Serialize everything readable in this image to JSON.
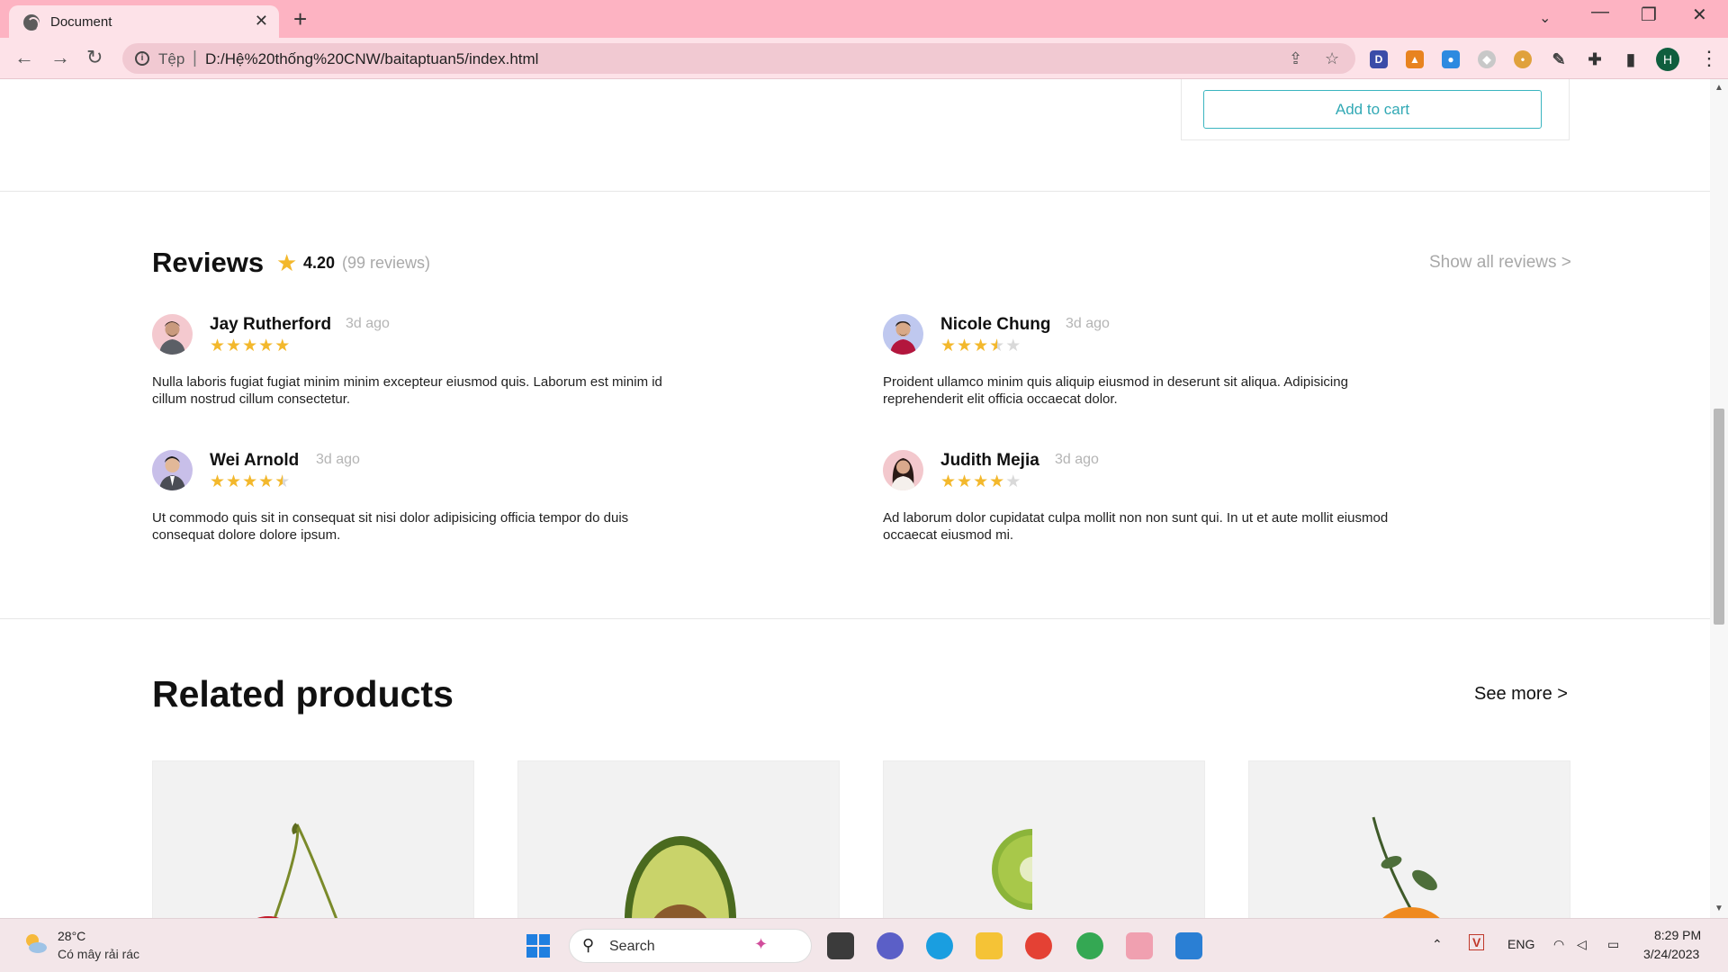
{
  "browser": {
    "tab_title": "Document",
    "url_scheme": "Tệp",
    "url": "D:/Hệ%20thống%20CNW/baitaptuan5/index.html",
    "profile_initial": "H"
  },
  "product": {
    "add_to_cart_label": "Add to cart"
  },
  "reviews": {
    "title": "Reviews",
    "rating": "4.20",
    "count_text": "(99 reviews)",
    "show_all": "Show all reviews >",
    "items": [
      {
        "name": "Jay Rutherford",
        "time": "3d ago",
        "rating": 5,
        "text": "Nulla laboris fugiat fugiat minim minim excepteur eiusmod quis. Laborum est minim id cillum nostrud cillum consectetur."
      },
      {
        "name": "Nicole Chung",
        "time": "3d ago",
        "rating": 3.5,
        "text": "Proident ullamco minim quis aliquip eiusmod in deserunt sit aliqua. Adipisicing reprehenderit elit officia occaecat dolor."
      },
      {
        "name": "Wei Arnold",
        "time": "3d ago",
        "rating": 4.5,
        "text": "Ut commodo quis sit in consequat sit nisi dolor adipisicing officia tempor do duis consequat dolore dolore ipsum."
      },
      {
        "name": "Judith Mejia",
        "time": "3d ago",
        "rating": 4,
        "text": "Ad laborum dolor cupidatat culpa mollit non non sunt qui. In ut et aute mollit eiusmod occaecat eiusmod mi."
      }
    ]
  },
  "related": {
    "title": "Related products",
    "see_more": "See more >",
    "products": [
      "cherry",
      "avocado",
      "kiwi",
      "tangerine"
    ]
  },
  "taskbar": {
    "temperature": "28°C",
    "weather": "Có mây rải rác",
    "search_label": "Search",
    "language": "ENG",
    "time": "8:29 PM",
    "date": "3/24/2023"
  },
  "colors": {
    "accent": "#32a9b5",
    "star": "#f3b82c",
    "tab_bar": "#fdb3c2"
  }
}
